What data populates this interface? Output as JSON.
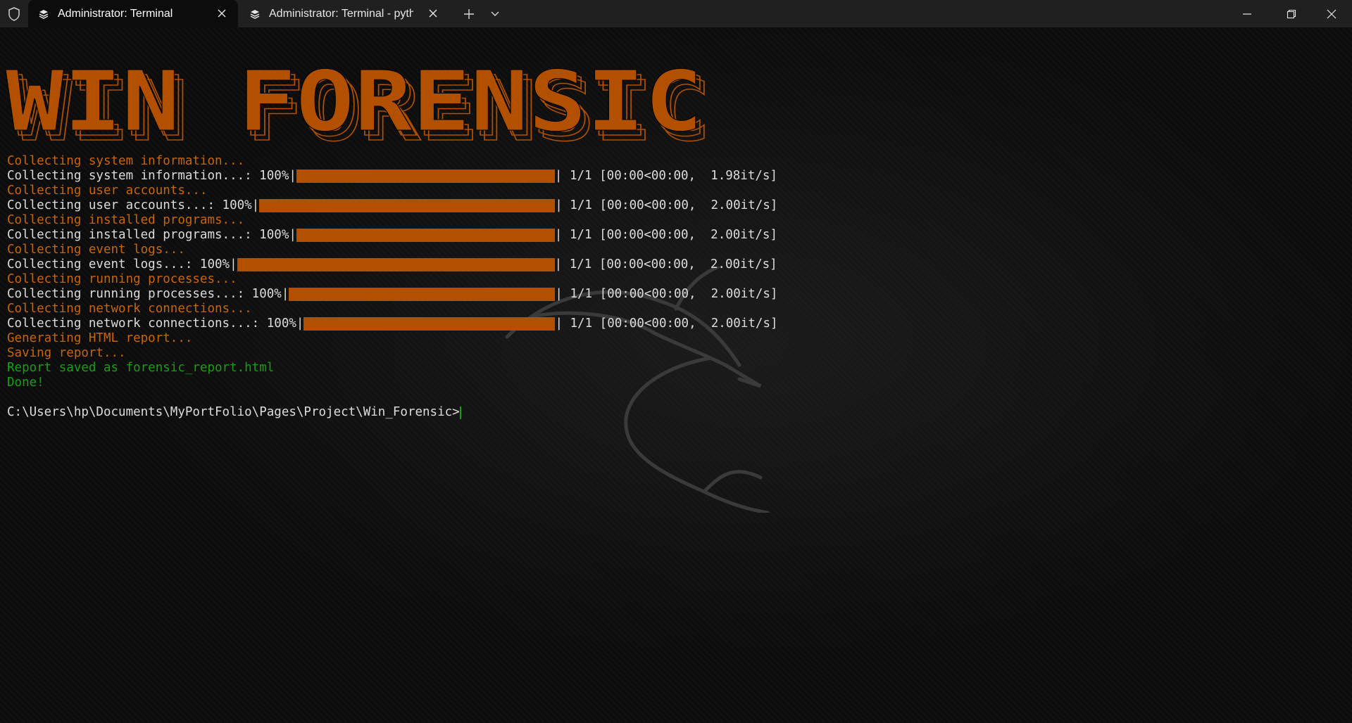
{
  "titlebar": {
    "tabs": [
      {
        "label": "Administrator: Terminal",
        "icon": "terminal-tab-icon",
        "active": true
      },
      {
        "label": "Administrator: Terminal - pytho",
        "icon": "terminal-tab-icon",
        "active": false
      }
    ],
    "icons": {
      "shield": "shield-icon",
      "new_tab": "plus-icon",
      "dropdown": "chevron-down-icon",
      "minimize": "minimize-icon",
      "maximize": "restore-icon",
      "close": "close-icon"
    }
  },
  "banner": {
    "text": "WIN FORENSIC",
    "color": "#b25000"
  },
  "colors": {
    "orange": "#c8650a",
    "white": "#dcdcdc",
    "green": "#13a10e",
    "bar": "#b25000"
  },
  "output": [
    {
      "type": "status",
      "text": "Collecting system information..."
    },
    {
      "type": "progress",
      "prefix": "Collecting system information...: 100%|",
      "percent": 100,
      "suffix": "| 1/1 [00:00<00:00,  1.98it/s]"
    },
    {
      "type": "status",
      "text": "Collecting user accounts..."
    },
    {
      "type": "progress",
      "prefix": "Collecting user accounts...: 100%|",
      "percent": 100,
      "suffix": "| 1/1 [00:00<00:00,  2.00it/s]"
    },
    {
      "type": "status",
      "text": "Collecting installed programs..."
    },
    {
      "type": "progress",
      "prefix": "Collecting installed programs...: 100%|",
      "percent": 100,
      "suffix": "| 1/1 [00:00<00:00,  2.00it/s]"
    },
    {
      "type": "status",
      "text": "Collecting event logs..."
    },
    {
      "type": "progress",
      "prefix": "Collecting event logs...: 100%|",
      "percent": 100,
      "suffix": "| 1/1 [00:00<00:00,  2.00it/s]"
    },
    {
      "type": "status",
      "text": "Collecting running processes..."
    },
    {
      "type": "progress",
      "prefix": "Collecting running processes...: 100%|",
      "percent": 100,
      "suffix": "| 1/1 [00:00<00:00,  2.00it/s]"
    },
    {
      "type": "status",
      "text": "Collecting network connections..."
    },
    {
      "type": "progress",
      "prefix": "Collecting network connections...: 100%|",
      "percent": 100,
      "suffix": "| 1/1 [00:00<00:00,  2.00it/s]"
    },
    {
      "type": "status",
      "text": "Generating HTML report..."
    },
    {
      "type": "status",
      "text": "Saving report..."
    },
    {
      "type": "success",
      "text": "Report saved as forensic_report.html"
    },
    {
      "type": "success",
      "text": "Done!"
    },
    {
      "type": "blank",
      "text": ""
    },
    {
      "type": "prompt",
      "text": "C:\\Users\\hp\\Documents\\MyPortFolio\\Pages\\Project\\Win_Forensic>"
    }
  ]
}
